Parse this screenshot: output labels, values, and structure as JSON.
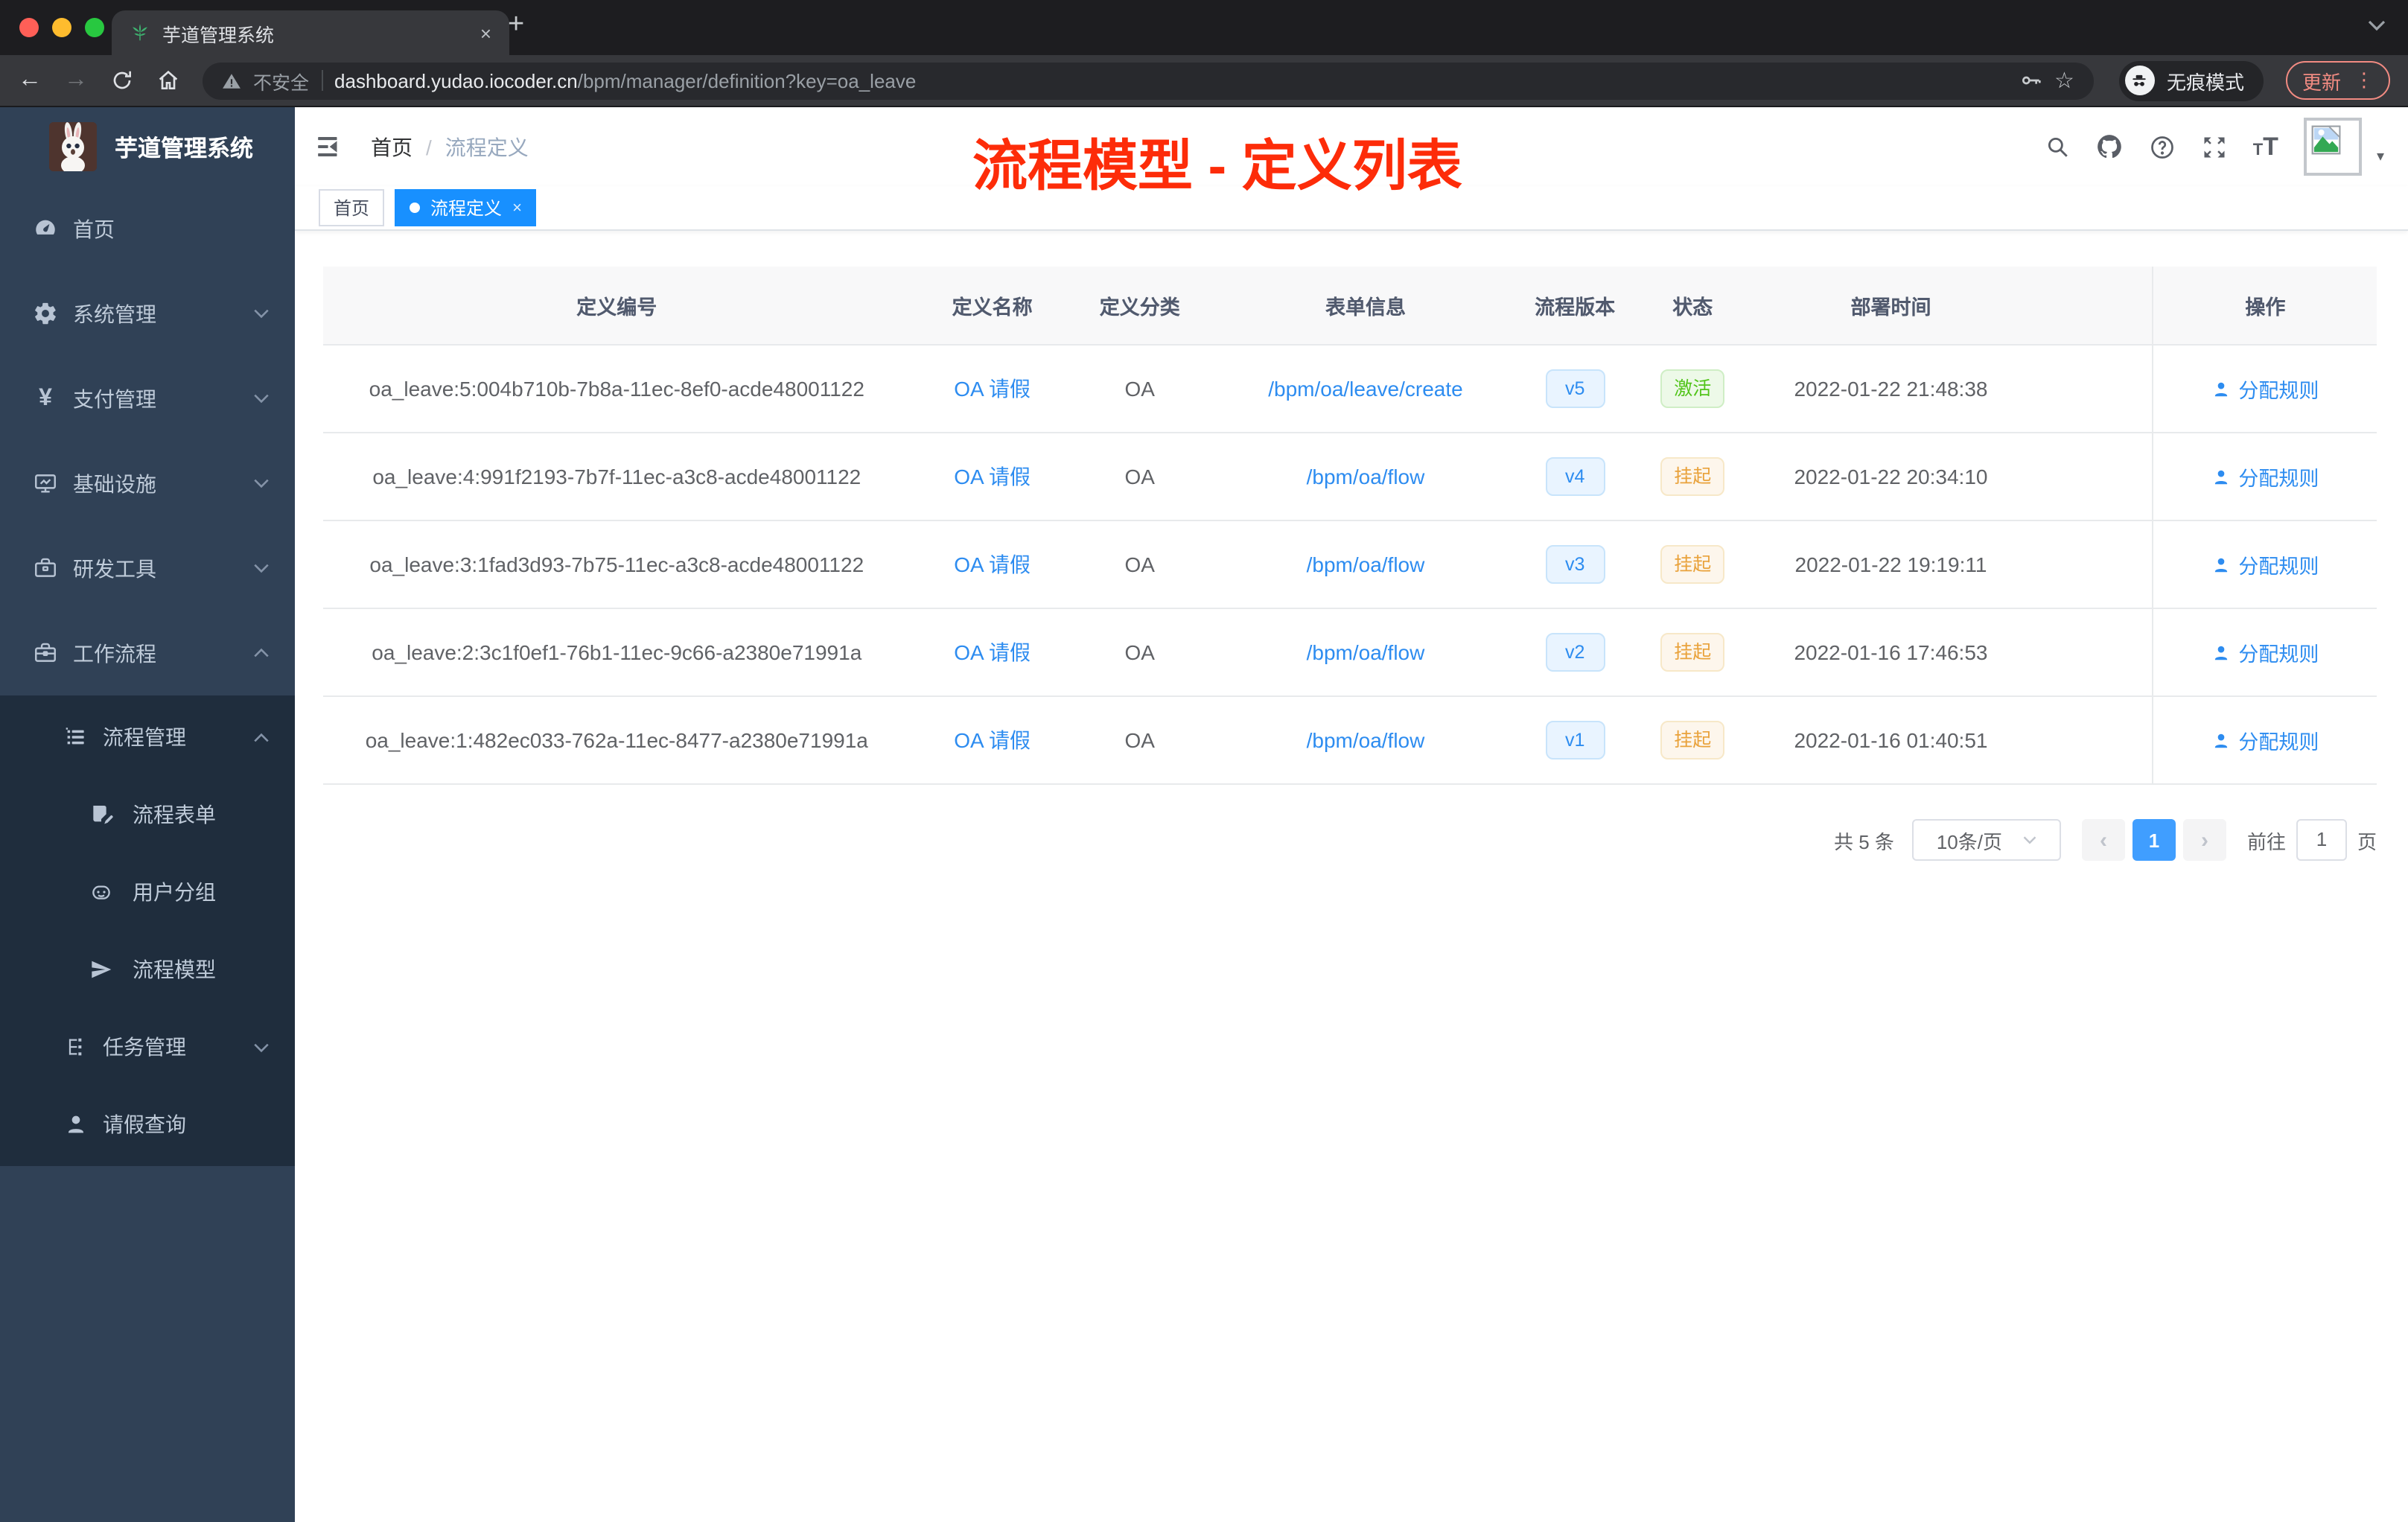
{
  "colors": {
    "accent_blue": "#409eff",
    "tag_active_blue": "#1890ff",
    "link_blue": "#2d8cf0",
    "success_green": "#52c41a",
    "warning_orange": "#e9a23b",
    "annotation_red": "#fd2c09",
    "sidebar_bg": "#304156",
    "submenu_bg": "#1f2d3d"
  },
  "browser": {
    "tab": {
      "title": "芋道管理系统",
      "close_glyph": "×",
      "new_tab_glyph": "+"
    },
    "back_glyph": "←",
    "forward_glyph": "→",
    "address": {
      "security_label": "不安全",
      "host": "dashboard.yudao.iocoder.cn",
      "path": "/bpm/manager/definition?key=oa_leave",
      "star_glyph": "☆"
    },
    "incognito_label": "无痕模式",
    "update_label": "更新",
    "menu_dots_glyph": "⋮",
    "strip_caret_glyph": "⌄",
    "profile_caret_glyph": "▾"
  },
  "annotation": {
    "text": "流程模型 - 定义列表"
  },
  "sidebar": {
    "logo_title": "芋道管理系统",
    "menu": [
      {
        "label": "首页",
        "icon": "dashboard-icon"
      },
      {
        "label": "系统管理",
        "icon": "gear-icon"
      },
      {
        "label": "支付管理",
        "icon": "yen-icon",
        "yen_glyph": "¥"
      },
      {
        "label": "基础设施",
        "icon": "monitor-icon"
      },
      {
        "label": "研发工具",
        "icon": "toolbox-icon"
      },
      {
        "label": "工作流程",
        "icon": "briefcase-icon"
      }
    ],
    "submenu": [
      {
        "label": "流程管理",
        "icon": "list-icon"
      },
      {
        "label": "流程表单",
        "icon": "form-icon"
      },
      {
        "label": "用户分组",
        "icon": "robot-icon"
      },
      {
        "label": "流程模型",
        "icon": "send-icon"
      },
      {
        "label": "任务管理",
        "icon": "tree-icon"
      },
      {
        "label": "请假查询",
        "icon": "user-icon"
      }
    ]
  },
  "navbar": {
    "breadcrumb": {
      "first": "首页",
      "separator": "/",
      "last": "流程定义"
    }
  },
  "tags": [
    {
      "label": "首页"
    },
    {
      "label": "流程定义",
      "close_glyph": "×"
    }
  ],
  "table": {
    "headers": [
      "定义编号",
      "定义名称",
      "定义分类",
      "表单信息",
      "流程版本",
      "状态",
      "部署时间",
      "操作"
    ],
    "rows": [
      {
        "id": "oa_leave:5:004b710b-7b8a-11ec-8ef0-acde48001122",
        "name": "OA 请假",
        "category": "OA",
        "form": "/bpm/oa/leave/create",
        "version": "v5",
        "status": "激活",
        "status_type": "success",
        "deploy_time": "2022-01-22 21:48:38",
        "action": "分配规则"
      },
      {
        "id": "oa_leave:4:991f2193-7b7f-11ec-a3c8-acde48001122",
        "name": "OA 请假",
        "category": "OA",
        "form": "/bpm/oa/flow",
        "version": "v4",
        "status": "挂起",
        "status_type": "warning",
        "deploy_time": "2022-01-22 20:34:10",
        "action": "分配规则"
      },
      {
        "id": "oa_leave:3:1fad3d93-7b75-11ec-a3c8-acde48001122",
        "name": "OA 请假",
        "category": "OA",
        "form": "/bpm/oa/flow",
        "version": "v3",
        "status": "挂起",
        "status_type": "warning",
        "deploy_time": "2022-01-22 19:19:11",
        "action": "分配规则"
      },
      {
        "id": "oa_leave:2:3c1f0ef1-76b1-11ec-9c66-a2380e71991a",
        "name": "OA 请假",
        "category": "OA",
        "form": "/bpm/oa/flow",
        "version": "v2",
        "status": "挂起",
        "status_type": "warning",
        "deploy_time": "2022-01-16 17:46:53",
        "action": "分配规则"
      },
      {
        "id": "oa_leave:1:482ec033-762a-11ec-8477-a2380e71991a",
        "name": "OA 请假",
        "category": "OA",
        "form": "/bpm/oa/flow",
        "version": "v1",
        "status": "挂起",
        "status_type": "warning",
        "deploy_time": "2022-01-16 01:40:51",
        "action": "分配规则"
      }
    ]
  },
  "pagination": {
    "total": "共 5 条",
    "page_size": "10条/页",
    "prev_glyph": "‹",
    "current_page": "1",
    "next_glyph": "›",
    "goto_label": "前往",
    "goto_value": "1",
    "goto_unit": "页"
  }
}
